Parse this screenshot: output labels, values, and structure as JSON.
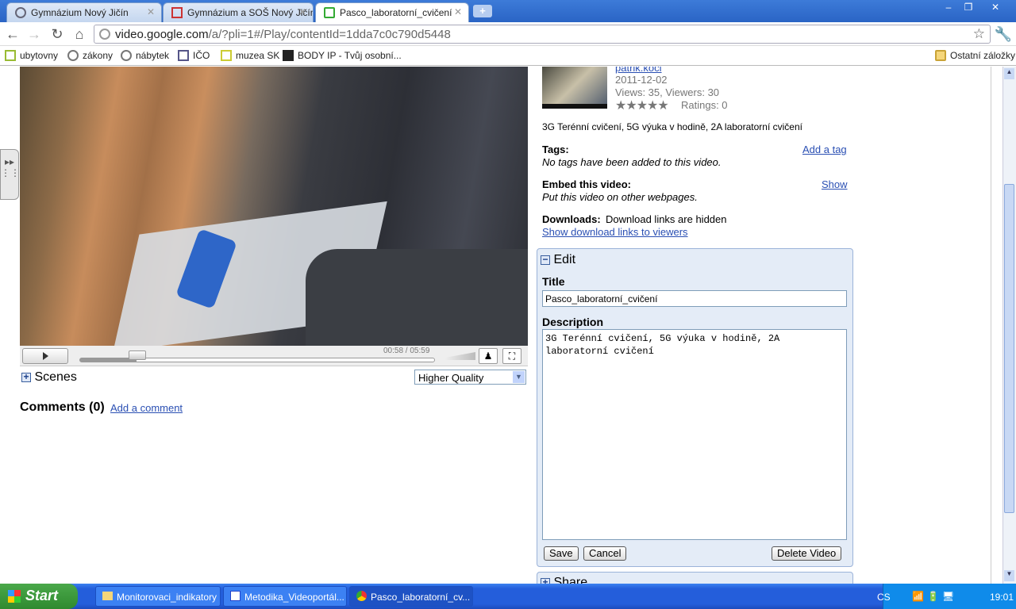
{
  "browser": {
    "tabs": [
      {
        "label": "Gymnázium Nový Jičín",
        "icon": "globe-icon"
      },
      {
        "label": "Gymnázium a SOŠ Nový Jičín M",
        "icon": "gmail-icon"
      },
      {
        "label": "Pasco_laboratorní_cvičení",
        "icon": "google-video-icon",
        "active": true
      }
    ],
    "url_host": "video.google.com",
    "url_rest": "/a/?pli=1#/Play/contentId=1dda7c0c790d5448",
    "bookmarks": [
      "ubytovny",
      "zákony",
      "nábytek",
      "IČO",
      "muzea SK",
      "BODY IP - Tvůj osobní..."
    ],
    "other_bookmarks": "Ostatní záložky"
  },
  "player": {
    "time": "00:58 / 05:59",
    "progress_fraction": 0.16,
    "scenes_label": "Scenes",
    "quality": "Higher Quality"
  },
  "comments": {
    "title": "Comments (0)",
    "add": "Add a comment"
  },
  "info": {
    "author": "patrik.koci",
    "date": "2011-12-02",
    "views": "Views: 35, Viewers: 30",
    "ratings": "Ratings: 0",
    "rating_stars": 0,
    "description": "3G Terénní cvičení, 5G výuka v hodině, 2A laboratorní cvičení",
    "tags_label": "Tags:",
    "tags_value": "No tags have been added to this video.",
    "add_tag": "Add a tag",
    "embed_label": "Embed this video:",
    "embed_value": "Put this video on other webpages.",
    "embed_show": "Show",
    "downloads_label": "Downloads:",
    "downloads_value": "Download links are hidden",
    "downloads_link": "Show download links to viewers"
  },
  "edit": {
    "header": "Edit",
    "title_label": "Title",
    "title_value": "Pasco_laboratorní_cvičení",
    "desc_label": "Description",
    "desc_value": "3G Terénní cvičení, 5G výuka v hodině, 2A laboratorní cvičení",
    "save": "Save",
    "cancel": "Cancel",
    "delete": "Delete Video"
  },
  "share": {
    "header": "Share"
  },
  "taskbar": {
    "start": "Start",
    "tasks": [
      "Monitorovaci_indikatory",
      "Metodika_Videoportál...",
      "Pasco_laboratorní_cv..."
    ],
    "lang": "CS",
    "clock": "19:01"
  }
}
